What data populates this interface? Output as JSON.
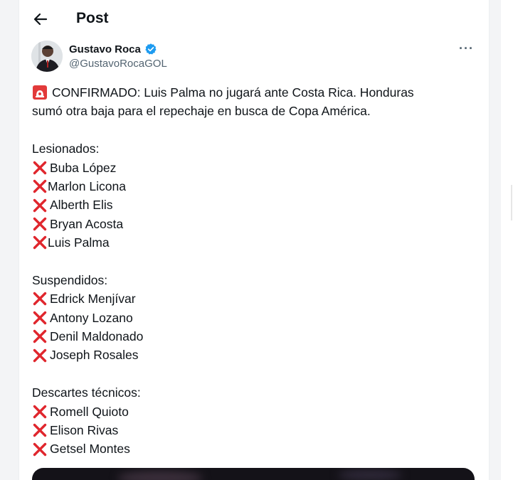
{
  "header": {
    "back_icon": "arrow-left-icon",
    "title": "Post"
  },
  "author": {
    "name": "Gustavo Roca",
    "handle": "@GustavoRocaGOL",
    "verified_color": "#1d9bf0",
    "more_label": "···"
  },
  "post": {
    "intro_emoji": "rotating-light-icon",
    "intro_line1": "CONFIRMADO: Luis Palma no jugará ante Costa Rica. Honduras",
    "intro_line2": "sumó otra baja para el repechaje en busca de Copa América.",
    "sections": [
      {
        "heading": "Lesionados:",
        "players": [
          {
            "name": "Buba López",
            "tight": false
          },
          {
            "name": "Marlon Licona",
            "tight": true
          },
          {
            "name": "Alberth Elis",
            "tight": false
          },
          {
            "name": "Bryan Acosta",
            "tight": false
          },
          {
            "name": "Luis Palma",
            "tight": true
          }
        ]
      },
      {
        "heading": "Suspendidos:",
        "players": [
          {
            "name": "Edrick Menjívar",
            "tight": false
          },
          {
            "name": "Antony Lozano",
            "tight": false
          },
          {
            "name": "Denil Maldonado",
            "tight": false
          },
          {
            "name": "Joseph Rosales",
            "tight": false
          }
        ]
      },
      {
        "heading": "Descartes técnicos:",
        "players": [
          {
            "name": "Romell Quioto",
            "tight": false
          },
          {
            "name": "Elison Rivas",
            "tight": false
          },
          {
            "name": "Getsel Montes",
            "tight": false
          }
        ]
      }
    ]
  },
  "colors": {
    "x_mark": "#e0262d",
    "text": "#0f1419",
    "muted": "#536471",
    "siren": "#e23a3a"
  }
}
